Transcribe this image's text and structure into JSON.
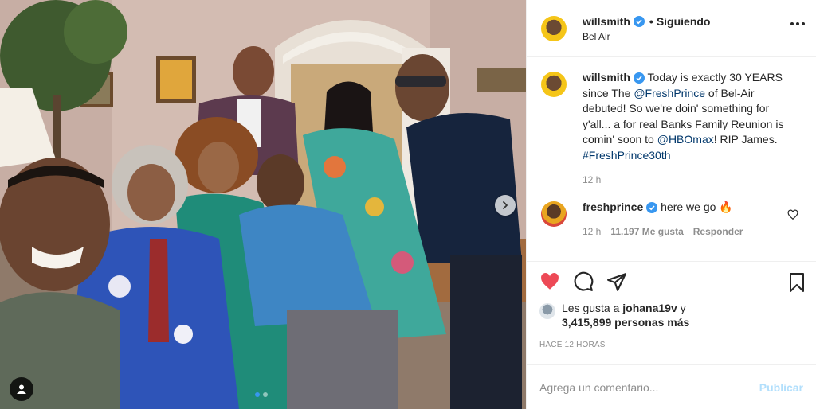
{
  "post": {
    "username": "willsmith",
    "follow_separator": "•",
    "follow_label": "Siguiendo",
    "location": "Bel Air"
  },
  "caption": {
    "username": "willsmith",
    "text_1": " Today is exactly 30 YEARS since The ",
    "mention_1": "@FreshPrince",
    "text_2": " of Bel-Air debuted! So we're doin' something for y'all... a for real Banks Family Reunion is comin' soon to ",
    "mention_2": "@HBOmax",
    "text_3": "! RIP James. ",
    "hashtag": "#FreshPrince30th",
    "time": "12 h"
  },
  "comment": {
    "username": "freshprince",
    "text": " here we go 🔥",
    "time": "12 h",
    "likes": "11.197 Me gusta",
    "reply": "Responder"
  },
  "likes": {
    "prefix": "Les gusta a ",
    "user": "johana19v",
    "mid": " y",
    "count": "3,415,899 personas más"
  },
  "timestamp": "HACE 12 HORAS",
  "add_comment": {
    "placeholder": "Agrega un comentario...",
    "publish": "Publicar"
  },
  "colors": {
    "verified": "#3897f0",
    "liked_heart": "#ed4956",
    "mention": "#00376b",
    "publish_disabled": "#b2dffc"
  },
  "icons": [
    "verified-badge-icon",
    "more-options-icon",
    "heart-icon",
    "comment-icon",
    "share-icon",
    "bookmark-icon",
    "chevron-right-icon",
    "user-tag-icon"
  ],
  "carousel": {
    "slides": 2,
    "active": 1
  }
}
